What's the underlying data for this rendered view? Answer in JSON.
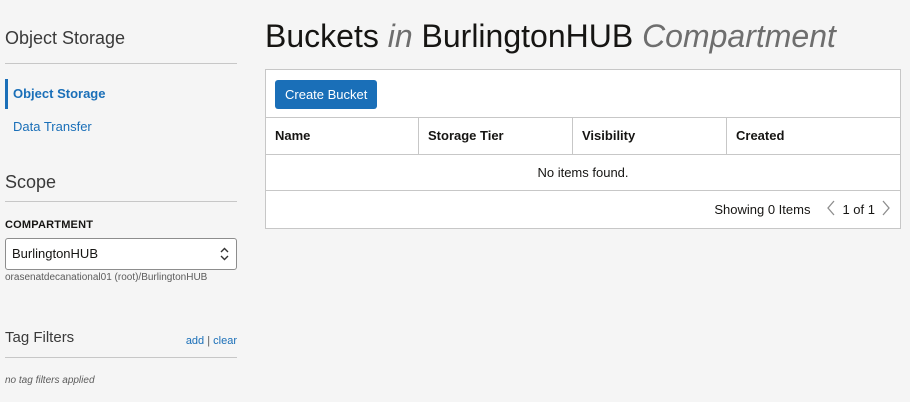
{
  "sidebar": {
    "heading": "Object Storage",
    "nav": [
      {
        "label": "Object Storage",
        "active": true
      },
      {
        "label": "Data Transfer",
        "active": false
      }
    ],
    "scope_heading": "Scope",
    "compartment_label": "COMPARTMENT",
    "compartment_value": "BurlingtonHUB",
    "compartment_path": "orasenatdecanational01 (root)/BurlingtonHUB",
    "tag_filters_heading": "Tag Filters",
    "tag_add": "add",
    "tag_separator": "|",
    "tag_clear": "clear",
    "no_tags_text": "no tag filters applied"
  },
  "main": {
    "title": {
      "part1": "Buckets",
      "part2": "in",
      "part3": "BurlingtonHUB",
      "part4": "Compartment"
    },
    "create_button": "Create Bucket",
    "columns": [
      "Name",
      "Storage Tier",
      "Visibility",
      "Created"
    ],
    "empty_text": "No items found.",
    "showing_text": "Showing 0 Items",
    "page_text": "1 of 1"
  },
  "colors": {
    "accent": "#1a6fb8",
    "background": "#f5f5f5"
  }
}
